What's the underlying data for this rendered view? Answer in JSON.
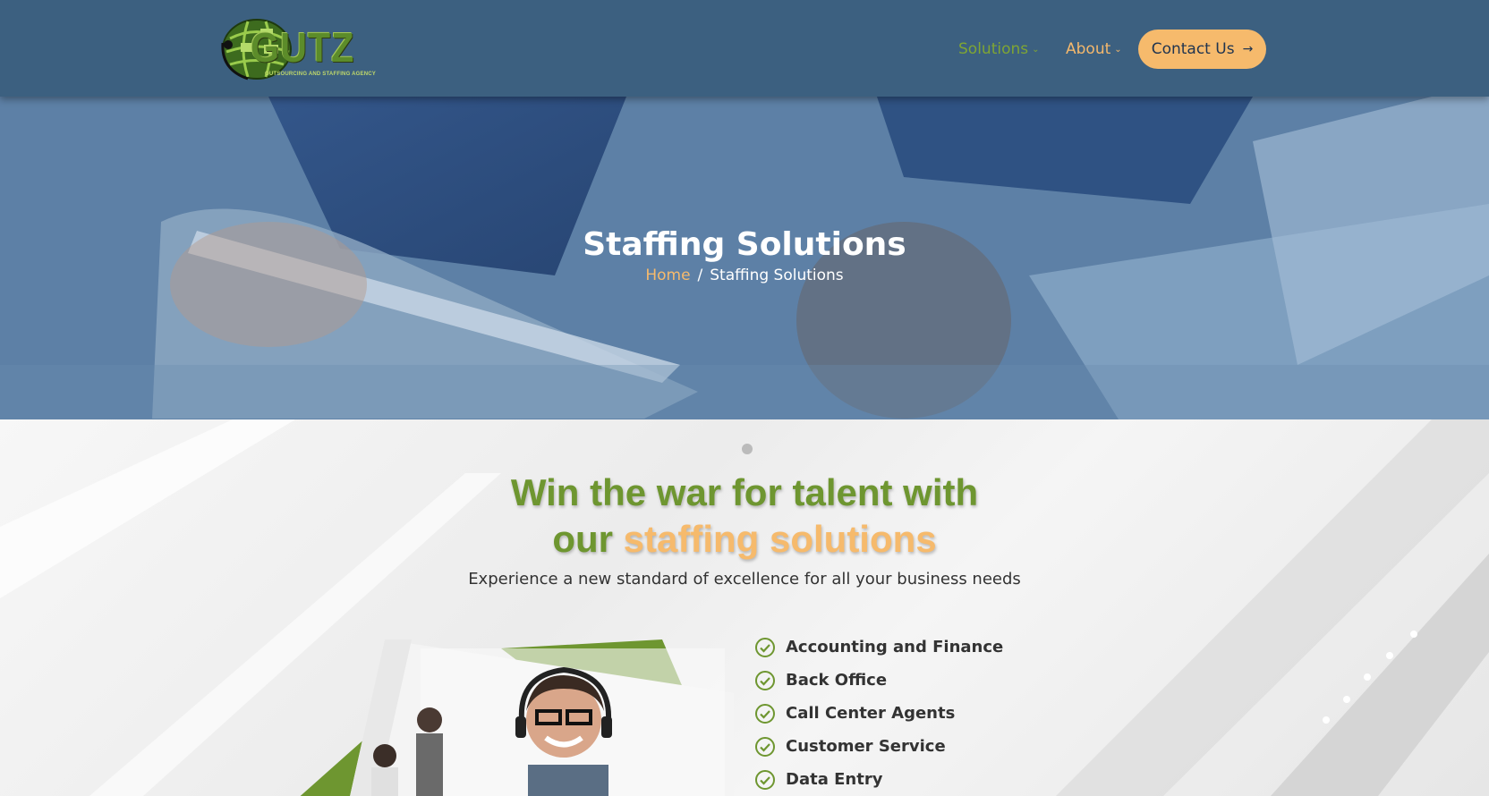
{
  "header": {
    "logo": {
      "text": "GUTZ",
      "subtitle": "OUTSOURCING AND STAFFING AGENCY"
    },
    "nav": [
      {
        "label": "Solutions",
        "icon": "chevron-down-icon",
        "active": true
      },
      {
        "label": "About",
        "icon": "chevron-down-icon"
      }
    ],
    "cta": {
      "label": "Contact Us",
      "icon": "arrow-right-icon"
    }
  },
  "hero": {
    "title": "Staffing Solutions",
    "breadcrumb": {
      "home": "Home",
      "separator": "/",
      "current": "Staffing Solutions"
    }
  },
  "main": {
    "headline_line1": "Win the war for talent with",
    "headline_prefix": "our",
    "headline_accent": "staffing solutions",
    "subheadline": "Experience a new standard of excellence for all your business needs",
    "features": [
      "Accounting and Finance",
      "Back Office",
      "Call Center Agents",
      "Customer Service",
      "Data Entry"
    ]
  },
  "colors": {
    "header_bg": "#3c6080",
    "brand_green": "#6e9630",
    "accent_orange": "#f6ba6c",
    "nav_active": "#7fa534"
  }
}
